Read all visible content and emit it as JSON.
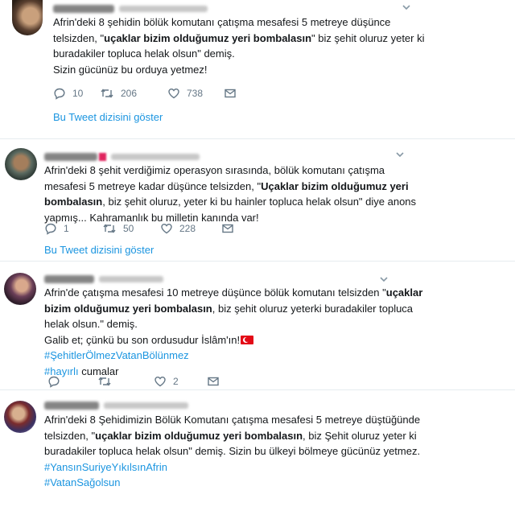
{
  "tweets": [
    {
      "lines": [
        [
          {
            "t": "Afrin'deki 8 şehidin bölük komutanı çatışma mesafesi 5 metreye düşünce"
          }
        ],
        [
          {
            "t": "telsizden, \""
          },
          {
            "t": "uçaklar bizim olduğumuz yeri bombalasın",
            "b": true
          },
          {
            "t": "\" biz şehit oluruz yeter ki"
          }
        ],
        [
          {
            "t": "buradakiler topluca helak olsun\" demiş."
          }
        ],
        [
          {
            "t": "Sizin gücünüz bu orduya yetmez!"
          }
        ]
      ],
      "replies": "10",
      "retweets": "206",
      "likes": "738",
      "thread_link": "Bu Tweet dizisini göster"
    },
    {
      "lines": [
        [
          {
            "t": "Afrin'deki 8 şehit verdiğimiz operasyon sırasında, bölük komutanı çatışma"
          }
        ],
        [
          {
            "t": "mesafesi 5 metreye kadar düşünce telsizden, \""
          },
          {
            "t": "Uçaklar bizim olduğumuz yeri",
            "b": true
          }
        ],
        [
          {
            "t": "bombalasın",
            "b": true
          },
          {
            "t": ", biz şehit oluruz, yeter ki bu hainler topluca helak olsun\" diye anons"
          }
        ],
        [
          {
            "t": "yapmış... Kahramanlık bu milletin kanında var!"
          }
        ]
      ],
      "replies": "1",
      "retweets": "50",
      "likes": "228",
      "thread_link": "Bu Tweet dizisini göster"
    },
    {
      "lines": [
        [
          {
            "t": "Afrin'de çatışma mesafesi 10 metreye düşünce bölük komutanı telsizden \""
          },
          {
            "t": "uçaklar",
            "b": true
          }
        ],
        [
          {
            "t": "bizim olduğumuz yeri bombalasın",
            "b": true
          },
          {
            "t": ", biz şehit oluruz yeterki buradakiler topluca"
          }
        ],
        [
          {
            "t": "helak olsun.\" demiş."
          }
        ],
        [
          {
            "t": "Galib et; çünkü bu son ordusudur İslâm'ın!"
          },
          {
            "flag": true
          }
        ],
        [
          {
            "t": "#ŞehitlerÖlmezVatanBölünmez",
            "tag": true
          }
        ],
        [
          {
            "t": "#hayırlı",
            "tag": true
          },
          {
            "t": " cumalar"
          }
        ]
      ],
      "replies": "",
      "retweets": "",
      "likes": "2"
    },
    {
      "lines": [
        [
          {
            "t": "Afrin'deki 8 Şehidimizin Bölük Komutanı çatışma mesafesi 5 metreye düştüğünde"
          }
        ],
        [
          {
            "t": "telsizden, \""
          },
          {
            "t": "uçaklar bizim olduğumuz yeri bombalasın",
            "b": true
          },
          {
            "t": ", biz Şehit oluruz yeter ki"
          }
        ],
        [
          {
            "t": "buradakiler topluca helak olsun\" demiş. Sizin bu ülkeyi bölmeye gücünüz yetmez."
          }
        ],
        [
          {
            "t": "#YansınSuriyeYıkılsınAfrin",
            "tag": true
          }
        ],
        [
          {
            "t": "#VatanSağolsun",
            "tag": true
          }
        ]
      ]
    }
  ],
  "colors": {
    "text": "#14171a",
    "muted": "#657786",
    "link": "#1b95e0",
    "flag_red": "#e30a17",
    "divider": "#e6ecf0"
  },
  "icons": [
    "reply-icon",
    "retweet-icon",
    "like-icon",
    "message-icon",
    "chevron-down-icon",
    "turkey-flag-icon"
  ]
}
